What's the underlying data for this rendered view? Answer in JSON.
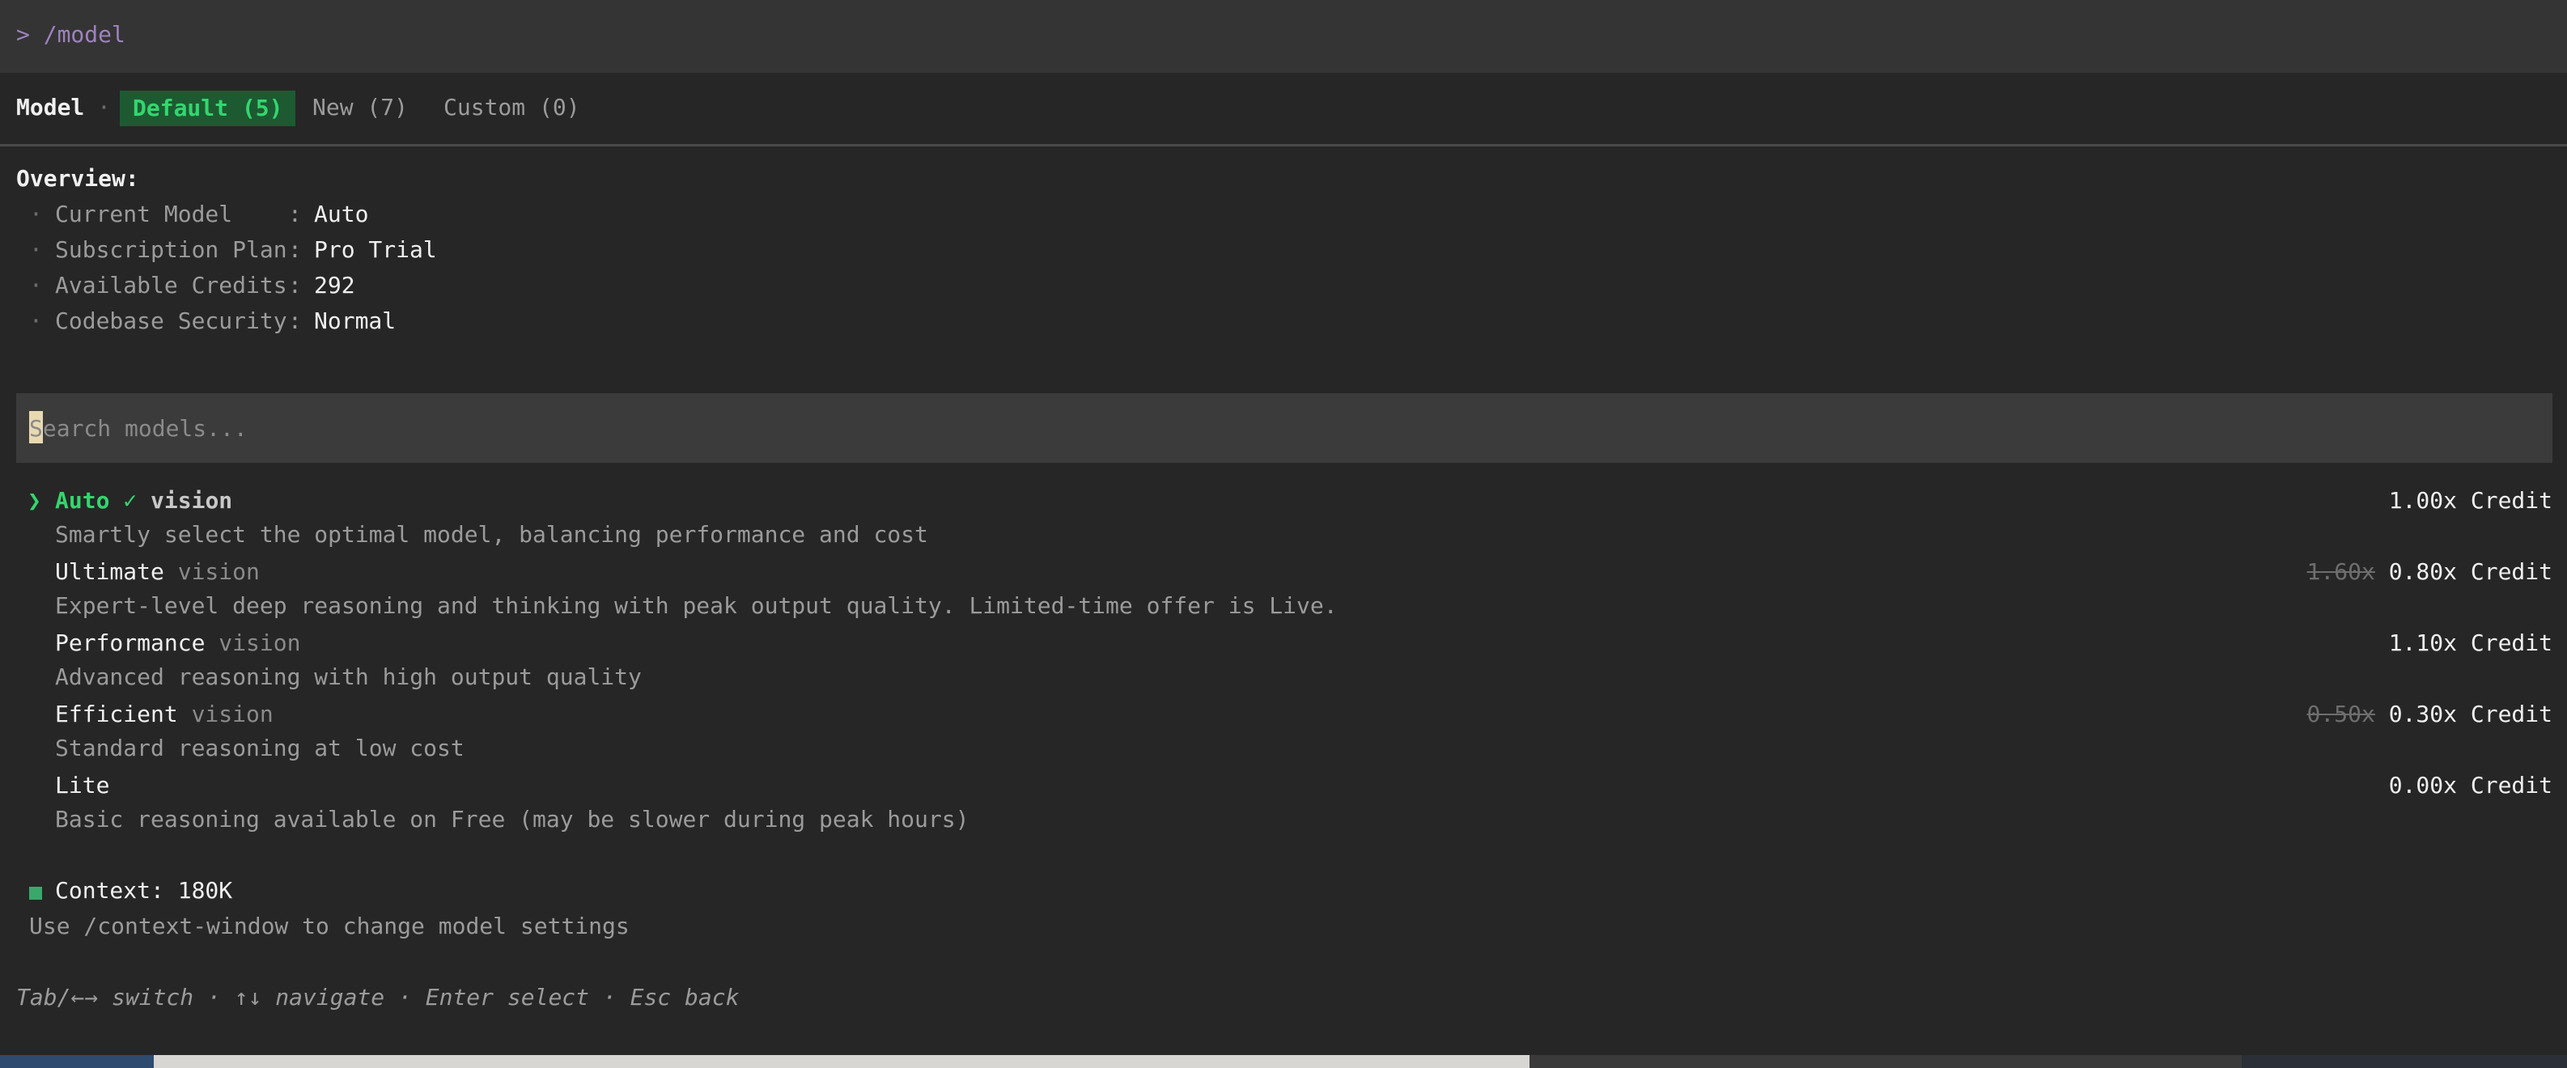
{
  "command": {
    "text": "> /model"
  },
  "tabs": {
    "title": "Model",
    "separator": "·",
    "items": [
      {
        "label": "Default (5)",
        "active": true
      },
      {
        "label": "New (7)",
        "active": false
      },
      {
        "label": "Custom (0)",
        "active": false
      }
    ]
  },
  "overview": {
    "heading": "Overview:",
    "rows": [
      {
        "bullet": "·",
        "label": "Current Model    ",
        "sep": ":",
        "value": "Auto"
      },
      {
        "bullet": "·",
        "label": "Subscription Plan",
        "sep": ":",
        "value": "Pro Trial"
      },
      {
        "bullet": "·",
        "label": "Available Credits",
        "sep": ":",
        "value": "292"
      },
      {
        "bullet": "·",
        "label": "Codebase Security",
        "sep": ":",
        "value": "Normal"
      }
    ]
  },
  "search": {
    "placeholder": "Search models..."
  },
  "models": [
    {
      "selected": true,
      "caret": "❯",
      "name": "Auto",
      "check": "✓",
      "tag": "vision",
      "old_credit": "",
      "credit": "1.00x Credit",
      "description": "Smartly select the optimal model, balancing performance and cost"
    },
    {
      "selected": false,
      "name": "Ultimate",
      "tag": "vision",
      "old_credit": "1.60x",
      "credit": "0.80x Credit",
      "description": "Expert-level deep reasoning and thinking with peak output quality. Limited-time offer is Live."
    },
    {
      "selected": false,
      "name": "Performance",
      "tag": "vision",
      "old_credit": "",
      "credit": "1.10x Credit",
      "description": "Advanced reasoning with high output quality"
    },
    {
      "selected": false,
      "name": "Efficient",
      "tag": "vision",
      "old_credit": "0.50x",
      "credit": "0.30x Credit",
      "description": "Standard reasoning at low cost"
    },
    {
      "selected": false,
      "name": "Lite",
      "tag": "",
      "old_credit": "",
      "credit": "0.00x Credit",
      "description": "Basic reasoning available on Free (may be slower during peak hours)"
    }
  ],
  "context": {
    "label": "Context: 180K",
    "hint": "Use /context-window to change model settings",
    "indicator_color": "#3aa86b"
  },
  "footer": {
    "hint": "Tab/←→ switch · ↑↓ navigate · Enter select · Esc back"
  },
  "colors": {
    "accent_green": "#33d66e",
    "active_tab_bg": "#1d5a32",
    "command_purple": "#9e82bf",
    "background": "#262626"
  }
}
